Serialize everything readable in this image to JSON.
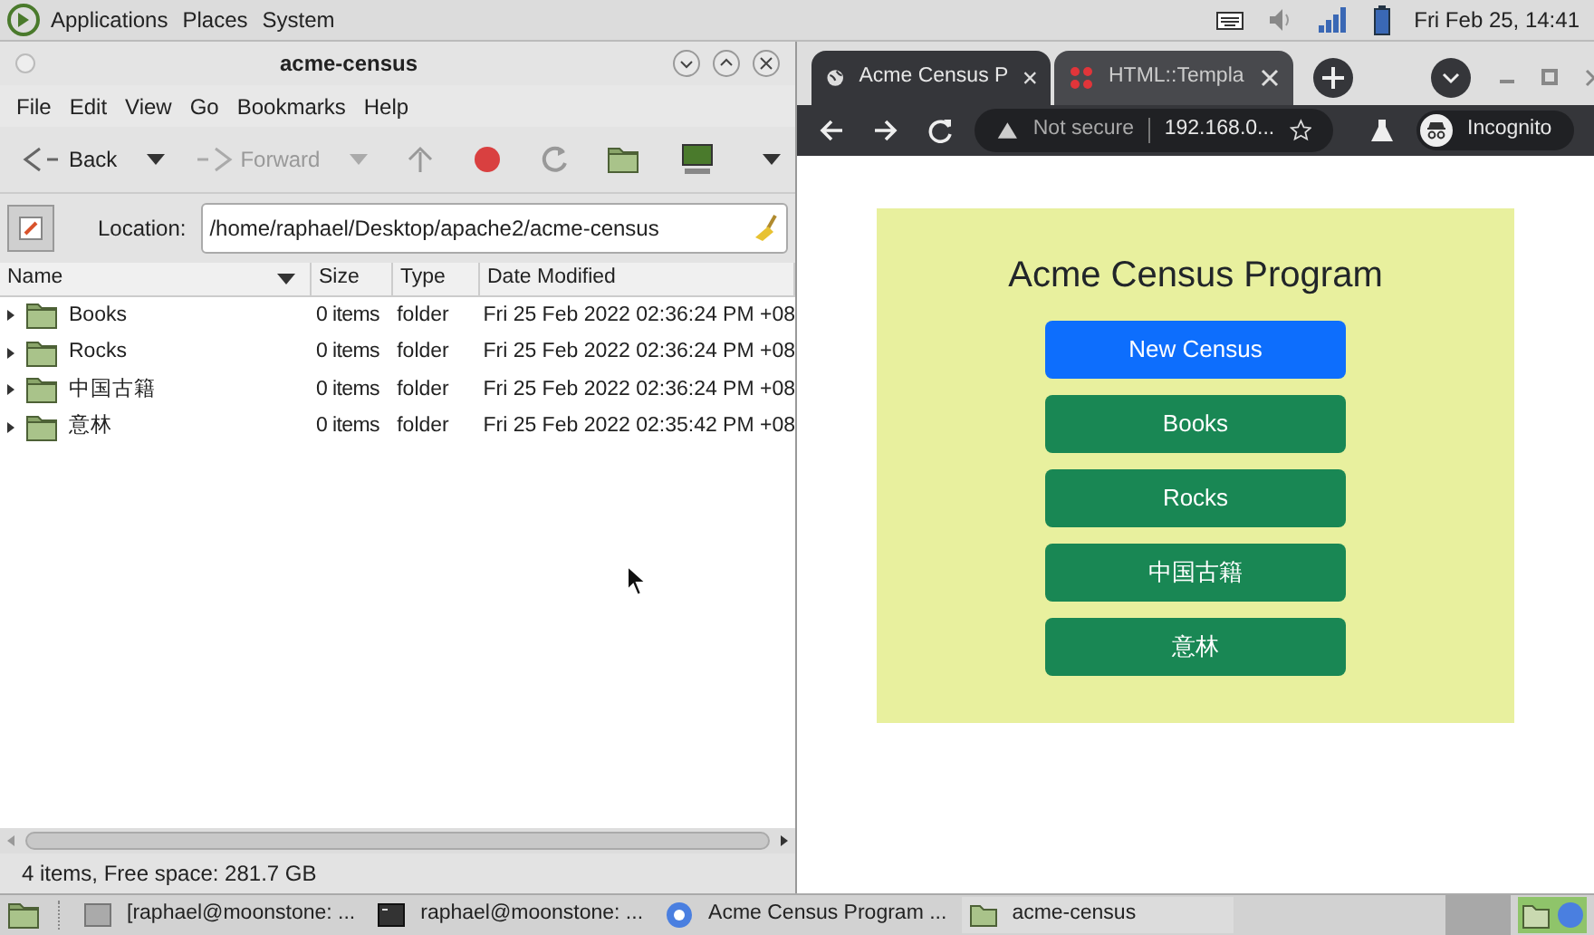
{
  "top_panel": {
    "menus": [
      "Applications",
      "Places",
      "System"
    ],
    "clock": "Fri Feb 25, 14:41"
  },
  "file_manager": {
    "title": "acme-census",
    "menu": [
      "File",
      "Edit",
      "View",
      "Go",
      "Bookmarks",
      "Help"
    ],
    "toolbar": [
      {
        "label": "Back",
        "disabled": false
      },
      {
        "label": "Forward",
        "disabled": true
      }
    ],
    "location": {
      "label": "Location:",
      "value": "/home/raphael/Desktop/apache2/acme-census"
    },
    "columns": [
      "Name",
      "Size",
      "Type",
      "Date Modified"
    ],
    "rows": [
      {
        "name": "Books",
        "size": "0 items",
        "type": "folder",
        "modified": "Fri 25 Feb 2022 02:36:24 PM +08"
      },
      {
        "name": "Rocks",
        "size": "0 items",
        "type": "folder",
        "modified": "Fri 25 Feb 2022 02:36:24 PM +08"
      },
      {
        "name": "中国古籍",
        "size": "0 items",
        "type": "folder",
        "modified": "Fri 25 Feb 2022 02:36:24 PM +08"
      },
      {
        "name": "意林",
        "size": "0 items",
        "type": "folder",
        "modified": "Fri 25 Feb 2022 02:35:42 PM +08"
      }
    ],
    "status": "4 items, Free space: 281.7 GB"
  },
  "browser": {
    "tabs": [
      {
        "title": "Acme Census P",
        "kind": "globe",
        "selected": true
      },
      {
        "title": "HTML::Templa",
        "kind": "dots",
        "selected": false
      }
    ],
    "security": "Not secure",
    "url": "192.168.0...",
    "profile": "Incognito",
    "page": {
      "heading": "Acme Census Program",
      "buttons": [
        {
          "label": "New Census",
          "kind": "primary"
        },
        {
          "label": "Books",
          "kind": "success"
        },
        {
          "label": "Rocks",
          "kind": "success"
        },
        {
          "label": "中国古籍",
          "kind": "success"
        },
        {
          "label": "意林",
          "kind": "success"
        }
      ]
    }
  },
  "taskbar": {
    "items": [
      {
        "label": "[raphael@moonstone: ...",
        "kind": "terminal-inactive"
      },
      {
        "label": "raphael@moonstone: ...",
        "kind": "terminal"
      },
      {
        "label": "Acme Census Program ...",
        "kind": "browser"
      },
      {
        "label": "acme-census",
        "kind": "folder"
      }
    ]
  }
}
